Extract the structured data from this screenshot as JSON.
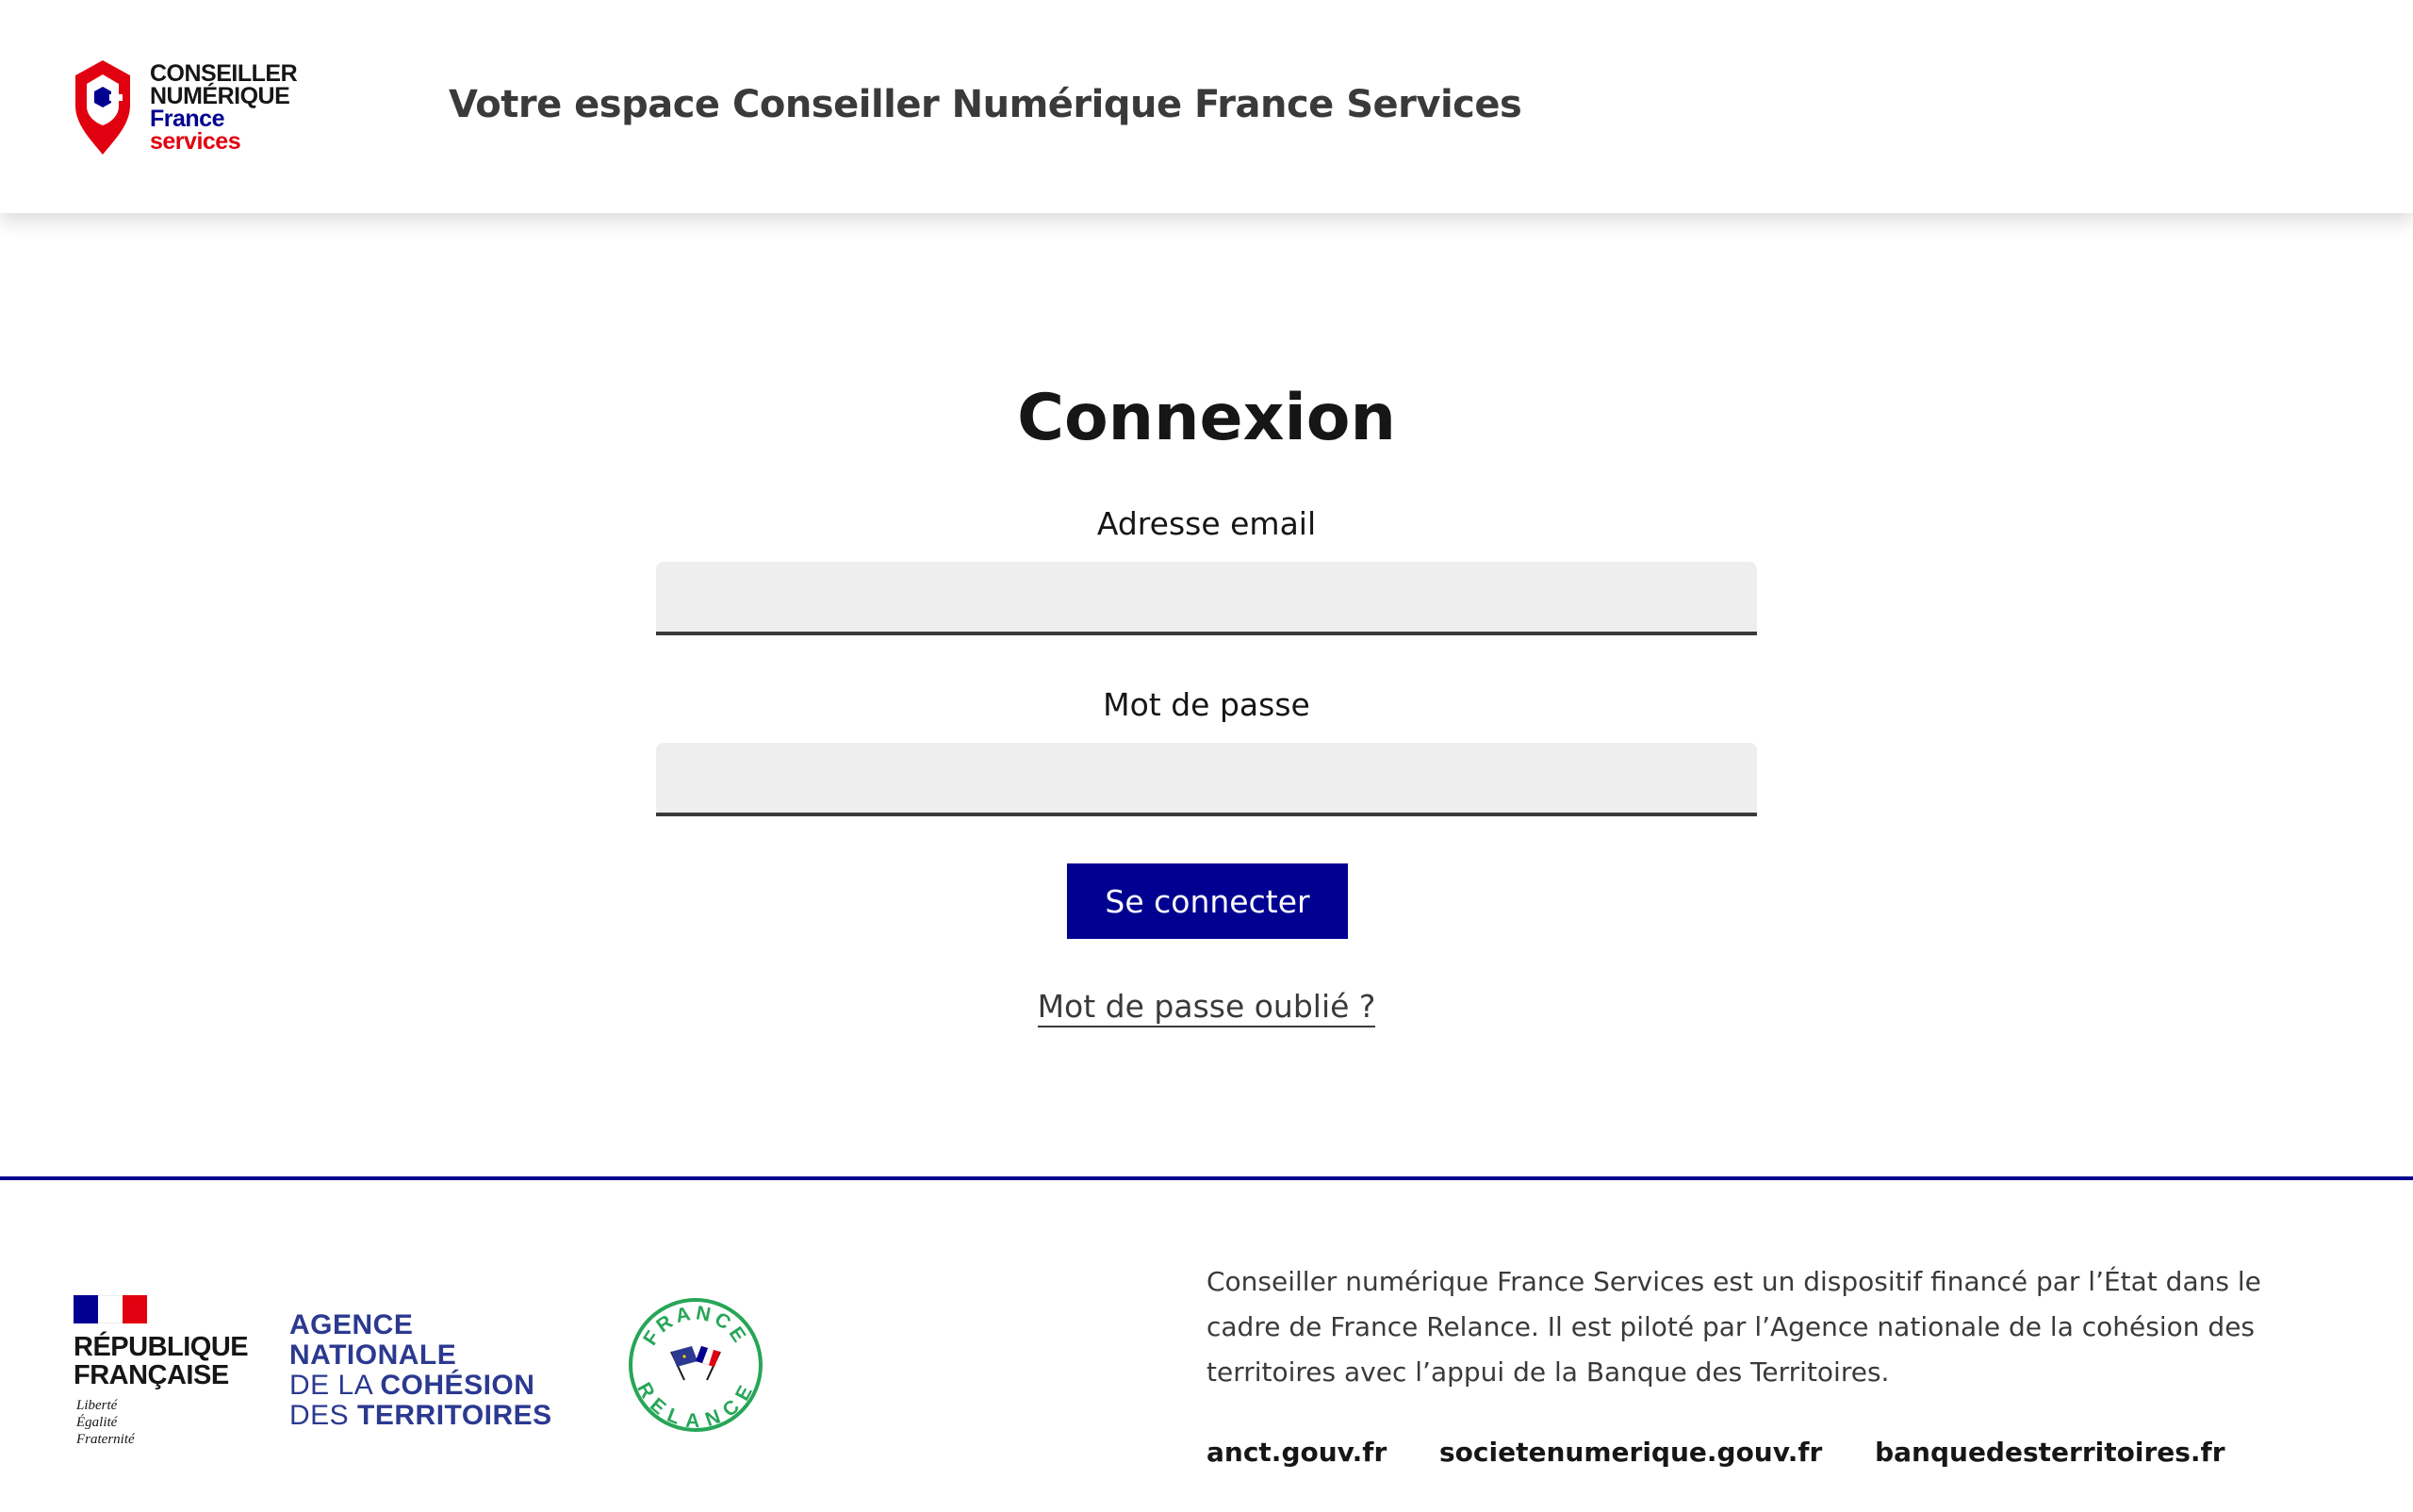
{
  "header": {
    "brand": {
      "line1": "CONSEILLER",
      "line2": "NUMÉRIQUE",
      "line3": "France",
      "line4": "services",
      "icon": "location-pin-logo-icon"
    },
    "title": "Votre espace Conseiller Numérique France Services"
  },
  "login": {
    "title": "Connexion",
    "email_label": "Adresse email",
    "email_value": "",
    "password_label": "Mot de passe",
    "password_value": "",
    "submit_label": "Se connecter",
    "forgot_label": "Mot de passe oublié ?"
  },
  "footer": {
    "republique": {
      "name_line1": "RÉPUBLIQUE",
      "name_line2": "FRANÇAISE",
      "motto": [
        "Liberté",
        "Égalité",
        "Fraternité"
      ]
    },
    "anct": {
      "line1": "AGENCE",
      "line2": "NATIONALE",
      "line3_light": "DE LA ",
      "line3_bold": "COHÉSION",
      "line4_light": "DES ",
      "line4_bold": "TERRITOIRES"
    },
    "relance": {
      "top": "FRANCE",
      "bottom": "RELANCE"
    },
    "description": "Conseiller numérique France Services est un dispositif financé par l’État dans le cadre de France Relance. Il est piloté par l’Agence nationale de la cohésion des territoires avec l’appui de la Banque des Territoires.",
    "links": [
      "anct.gouv.fr",
      "societenumerique.gouv.fr",
      "banquedesterritoires.fr"
    ]
  },
  "colors": {
    "blue_france": "#000091",
    "red_marianne": "#e1000f",
    "anct_blue": "#2b3990",
    "relance_green": "#27a658",
    "input_bg": "#eeeeee",
    "text_dark": "#161616",
    "text_grey": "#3a3a3a"
  }
}
